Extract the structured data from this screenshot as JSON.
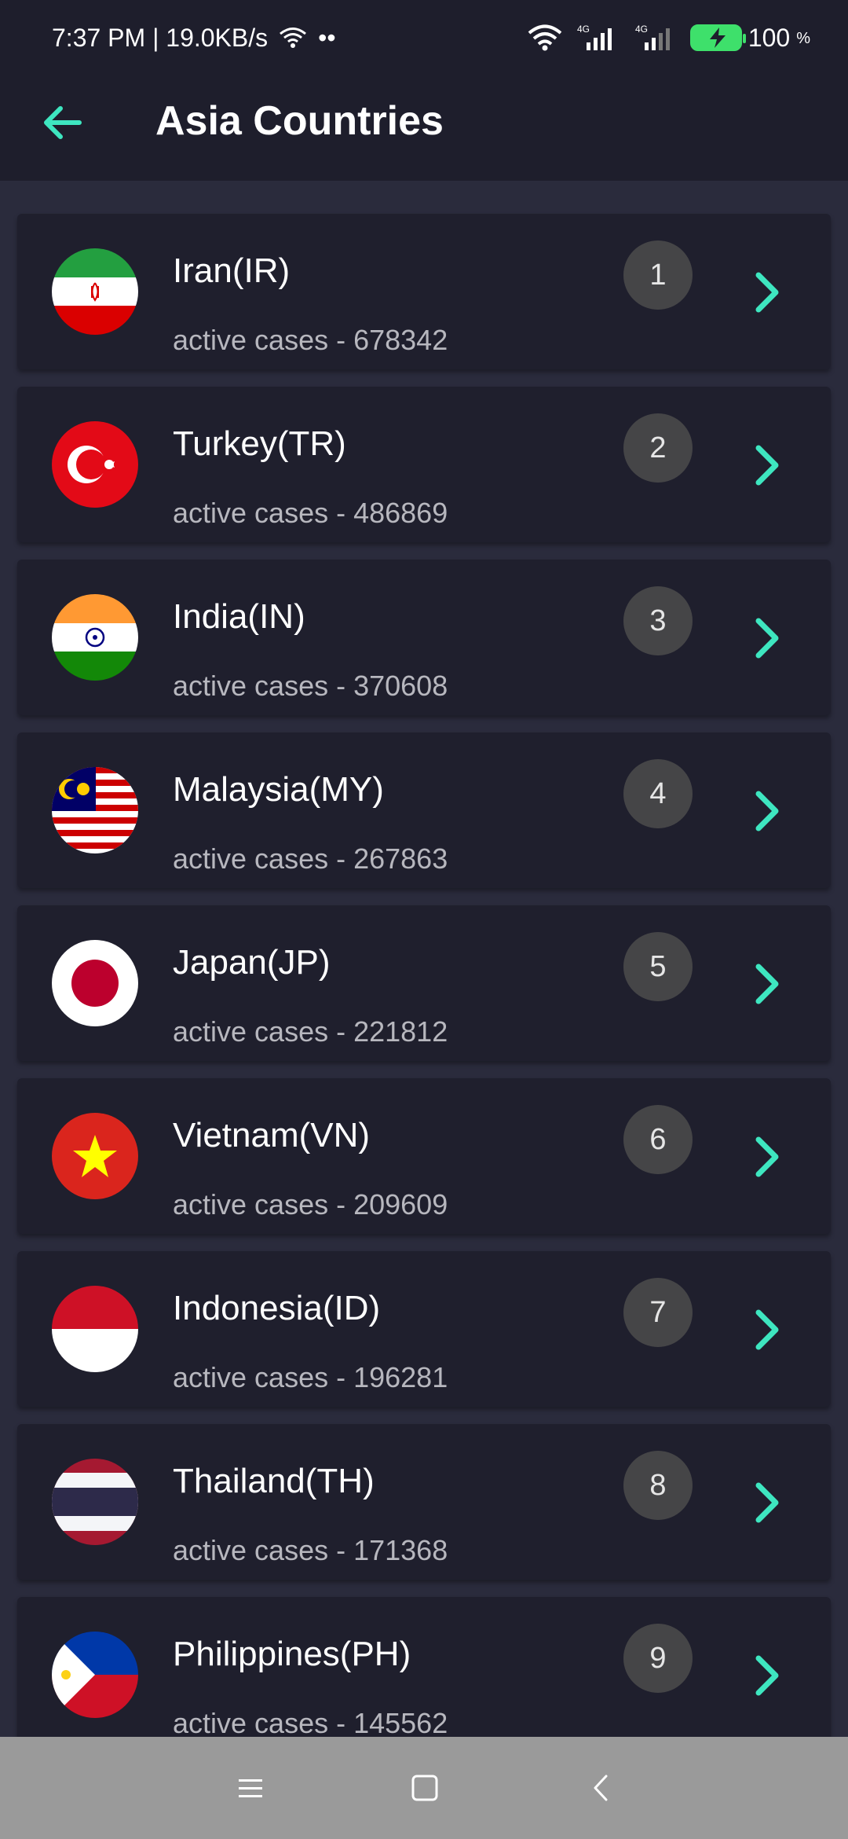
{
  "status_bar": {
    "time_speed": "7:37 PM | 19.0KB/s",
    "dots": "••",
    "net1": "4G",
    "net2": "4G",
    "battery": "100",
    "percent": "%"
  },
  "header": {
    "title": "Asia Countries",
    "back_icon": "arrow-left-icon"
  },
  "countries": [
    {
      "name": "Iran(IR)",
      "cases": "active cases - 678342",
      "rank": "1",
      "flag": "iran"
    },
    {
      "name": "Turkey(TR)",
      "cases": "active cases - 486869",
      "rank": "2",
      "flag": "turkey"
    },
    {
      "name": "India(IN)",
      "cases": "active cases - 370608",
      "rank": "3",
      "flag": "india"
    },
    {
      "name": "Malaysia(MY)",
      "cases": "active cases - 267863",
      "rank": "4",
      "flag": "malaysia"
    },
    {
      "name": "Japan(JP)",
      "cases": "active cases - 221812",
      "rank": "5",
      "flag": "japan"
    },
    {
      "name": "Vietnam(VN)",
      "cases": "active cases - 209609",
      "rank": "6",
      "flag": "vietnam"
    },
    {
      "name": "Indonesia(ID)",
      "cases": "active cases - 196281",
      "rank": "7",
      "flag": "indonesia"
    },
    {
      "name": "Thailand(TH)",
      "cases": "active cases - 171368",
      "rank": "8",
      "flag": "thailand"
    },
    {
      "name": "Philippines(PH)",
      "cases": "active cases - 145562",
      "rank": "9",
      "flag": "philippines"
    }
  ],
  "nav": {
    "menu_icon": "menu-icon",
    "home_icon": "home-square-icon",
    "back_icon": "back-triangle-icon"
  },
  "colors": {
    "accent": "#3ee6c0",
    "background": "#2a2b3c",
    "card": "#1f1f2d",
    "header": "#1e1e2c",
    "rank_badge": "#454547",
    "nav_bar": "#9a9a9a"
  }
}
